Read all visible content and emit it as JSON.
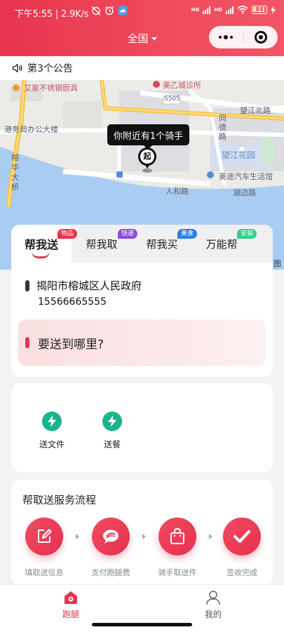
{
  "status_bar": {
    "time": "下午5:55",
    "speed": "2.9K/s",
    "network_1": "HD",
    "network_2": "HD",
    "battery": "94"
  },
  "header": {
    "city": "全国",
    "bg_color": "#e8344f"
  },
  "notice": {
    "text": "第3个公告"
  },
  "map": {
    "labels": {
      "store": "艾家不锈钢厨具",
      "office": "港务局办公大楼",
      "bridge_1": "榕",
      "bridge_2": "华",
      "bridge_3": "大",
      "bridge_4": "桥",
      "clinic": "美乙城诊所",
      "road_code": "S505",
      "wangjiang_road": "望江北路",
      "tongde_1": "同",
      "tongde_2": "德",
      "tongde_3": "路",
      "garden": "望江花园",
      "auto": "美途汽车生活馆",
      "renhe": "人和路",
      "hubian": "湖边路",
      "edge": "图"
    },
    "bubble": "你附近有1个骑手",
    "pin_text": "起"
  },
  "service_tabs": [
    {
      "label": "帮我送",
      "badge": "物品",
      "badge_color": "#e8344f"
    },
    {
      "label": "帮我取",
      "badge": "快递",
      "badge_color": "#8a4fd8"
    },
    {
      "label": "帮我买",
      "badge": "美食",
      "badge_color": "#2f7de8"
    },
    {
      "label": "万能帮",
      "badge": "安装",
      "badge_color": "#2fd18a"
    }
  ],
  "sender": {
    "address": "揭阳市榕城区人民政府",
    "phone": "15566665555"
  },
  "destination": {
    "placeholder": "要送到哪里?"
  },
  "quick_services": [
    {
      "label": "送文件",
      "icon": "lightning-icon"
    },
    {
      "label": "送餐",
      "icon": "lightning-icon"
    }
  ],
  "process": {
    "title": "帮取送服务流程",
    "steps": [
      {
        "label": "填取送信息",
        "icon": "edit-icon"
      },
      {
        "label": "支付跑腿费",
        "icon": "chat-icon"
      },
      {
        "label": "骑手取送件",
        "icon": "bag-icon"
      },
      {
        "label": "签收完成",
        "icon": "check-icon"
      }
    ]
  },
  "tab_bar": {
    "items": [
      {
        "label": "跑腿",
        "active": true
      },
      {
        "label": "我的",
        "active": false
      }
    ],
    "active_color": "#e8344f"
  }
}
